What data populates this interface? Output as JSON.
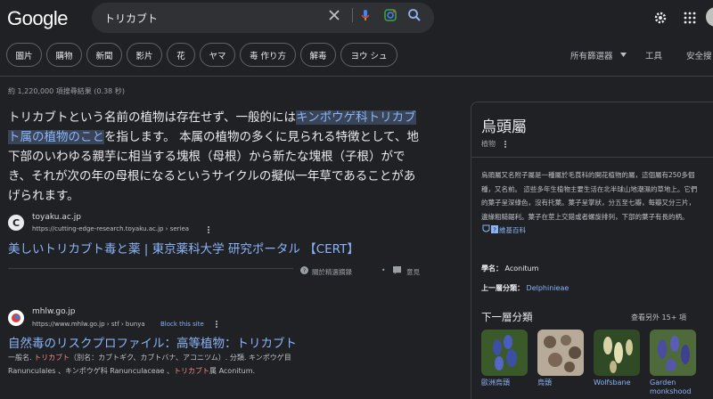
{
  "header": {
    "logo": "Google",
    "search_value": "トリカブト"
  },
  "chips": [
    "圖片",
    "購物",
    "新聞",
    "影片",
    "花",
    "ヤマ",
    "毒 作り方",
    "解毒",
    "ヨウ シュ"
  ],
  "tools": {
    "filters": "所有篩選器",
    "tools": "工具",
    "safe": "安全搜"
  },
  "stats": "約 1,220,000 項搜尋結果 (0.38 秒)",
  "snippet": {
    "pre": "トリカブトという名前の植物は存在せず、一般的には",
    "highlight": "キンポウゲ科トリカブト属の植物のこと",
    "post": "を指します。 本属の植物の多くに見られる特徴として、地下部のいわゆる親芋に相当する塊根（母根）から新たな塊根（子根）ができ、それが次の年の母根になるというサイクルの擬似一年草であることがあげられます。"
  },
  "result1": {
    "site": "toyaku.ac.jp",
    "url": "https://cutting-edge-research.toyaku.ac.jp › seriea",
    "title": "美しいトリカブト毒と薬 | 東京薬科大学 研究ポータル 【CERT】",
    "about": "關於精選摘錄",
    "feedback": "意見"
  },
  "result2": {
    "site": "mhlw.go.jp",
    "url": "https://www.mhlw.go.jp › stf › bunya",
    "block": "Block this site",
    "title": "自然毒のリスクプロファイル：高等植物：トリカブト",
    "d1a": "一般名. ",
    "d1b": "トリカブト",
    "d1c": "（別名：カブトギク、カブトバナ、アコニツム）. 分類. キンポウゲ目",
    "d2a": "Ranunculales 、キンポウゲ科 Ranunculaceae 、",
    "d2b": "トリカブト",
    "d2c": "属 Aconitum."
  },
  "panel": {
    "title": "烏頭屬",
    "subtitle": "植物",
    "desc": "烏頭屬又名附子屬是一種屬於毛茛科的開花植物的屬，這個屬有250多個種，又名前。 這些多年生植物主要生活在北半球山地潮濕的草地上。它們的葉子呈深綠色，沒有托葉。葉子呈掌狀，分五至七瓣，每瓣又分三片，邊緣粗糙鋸利。葉子在莖上交錯或者螺旋排列，下部的葉子有長的柄。",
    "wiki": "維基百科",
    "species_label": "學名：",
    "species": "Aconitum",
    "parent_label": "上一層分類：",
    "parent": "Delphinieae",
    "sub_title": "下一層分類",
    "sub_more": "查看另外 15+ 項",
    "thumbs": [
      {
        "label": "歐洲烏頭",
        "color": "#3d4fa3"
      },
      {
        "label": "烏頭",
        "color": "#8b7a6a"
      },
      {
        "label": "Wolfsbane",
        "color": "#c9c08a"
      },
      {
        "label": "Garden monkshood",
        "color": "#4a4ca0"
      }
    ]
  }
}
